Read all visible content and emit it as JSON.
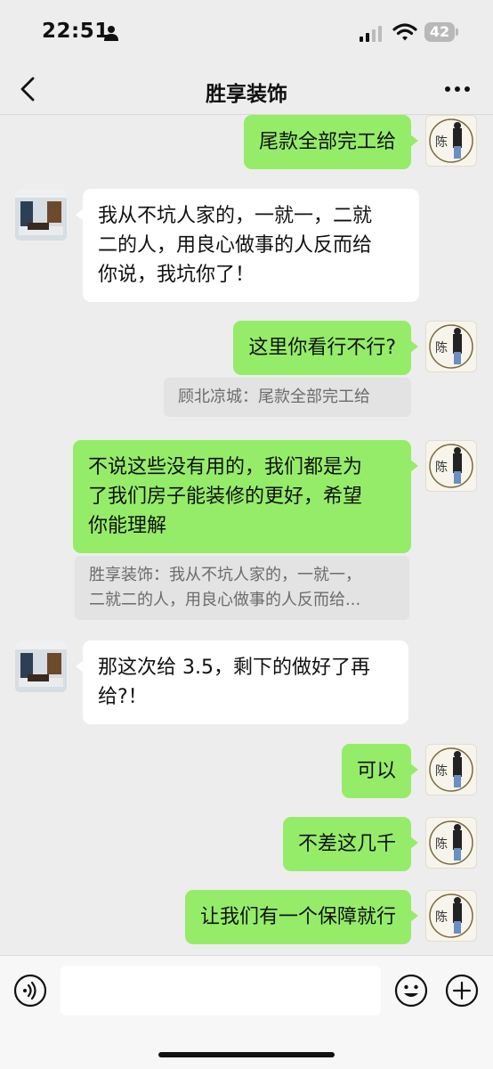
{
  "status_bar": {
    "time": "22:51",
    "battery": "42"
  },
  "header": {
    "title": "胜享装饰"
  },
  "messages": [
    {
      "side": "me",
      "lines": [
        "尾款全部完工给"
      ]
    },
    {
      "side": "other",
      "lines": [
        "我从不坑人家的，一就一，二就",
        "二的人，用良心做事的人反而给",
        "你说，我坑你了！"
      ]
    },
    {
      "side": "me",
      "lines": [
        "这里你看行不行?"
      ]
    },
    {
      "side": "quote",
      "lines": [
        "顾北凉城：尾款全部完工给"
      ]
    },
    {
      "side": "me",
      "lines": [
        "不说这些没有用的，我们都是为",
        "了我们房子能装修的更好，希望",
        "你能理解"
      ]
    },
    {
      "side": "quote",
      "lines": [
        "胜享装饰：我从不坑人家的，一就一，",
        "二就二的人，用良心做事的人反而给..."
      ]
    },
    {
      "side": "other",
      "lines": [
        "那这次给 3.5，剩下的做好了再",
        "给?！"
      ]
    },
    {
      "side": "me",
      "lines": [
        "可以"
      ]
    },
    {
      "side": "me",
      "lines": [
        "不差这几千"
      ]
    },
    {
      "side": "me",
      "lines": [
        "让我们有一个保障就行"
      ]
    }
  ],
  "avatars": {
    "me_seal_char": "陈"
  },
  "input_bar": {
    "placeholder": ""
  },
  "colors": {
    "background": "#ededed",
    "my_bubble": "#95ec69",
    "other_bubble": "#ffffff",
    "quote_bg": "#e3e3e3"
  },
  "icons": {
    "back": "chevron-left-icon",
    "more": "more-dots-icon",
    "voice": "voice-icon",
    "emoji": "emoji-icon",
    "plus": "plus-icon"
  }
}
